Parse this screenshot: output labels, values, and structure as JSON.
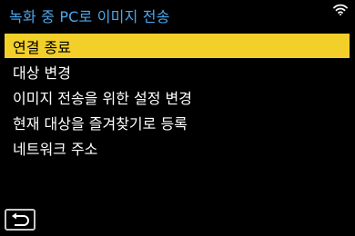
{
  "header": {
    "title": "녹화 중 PC로 이미지 전송"
  },
  "status": {
    "wifi_icon": "wifi-icon"
  },
  "menu": {
    "selected_index": 0,
    "items": [
      {
        "label": "연결 종료"
      },
      {
        "label": "대상 변경"
      },
      {
        "label": "이미지 전송을 위한 설정 변경"
      },
      {
        "label": "현재 대상을 즐겨찾기로 등록"
      },
      {
        "label": "네트워크 주소"
      }
    ]
  },
  "footer": {
    "back_icon": "return-icon"
  },
  "colors": {
    "title": "#4aa8f0",
    "selection": "#f3cf2a",
    "background": "#000000"
  }
}
